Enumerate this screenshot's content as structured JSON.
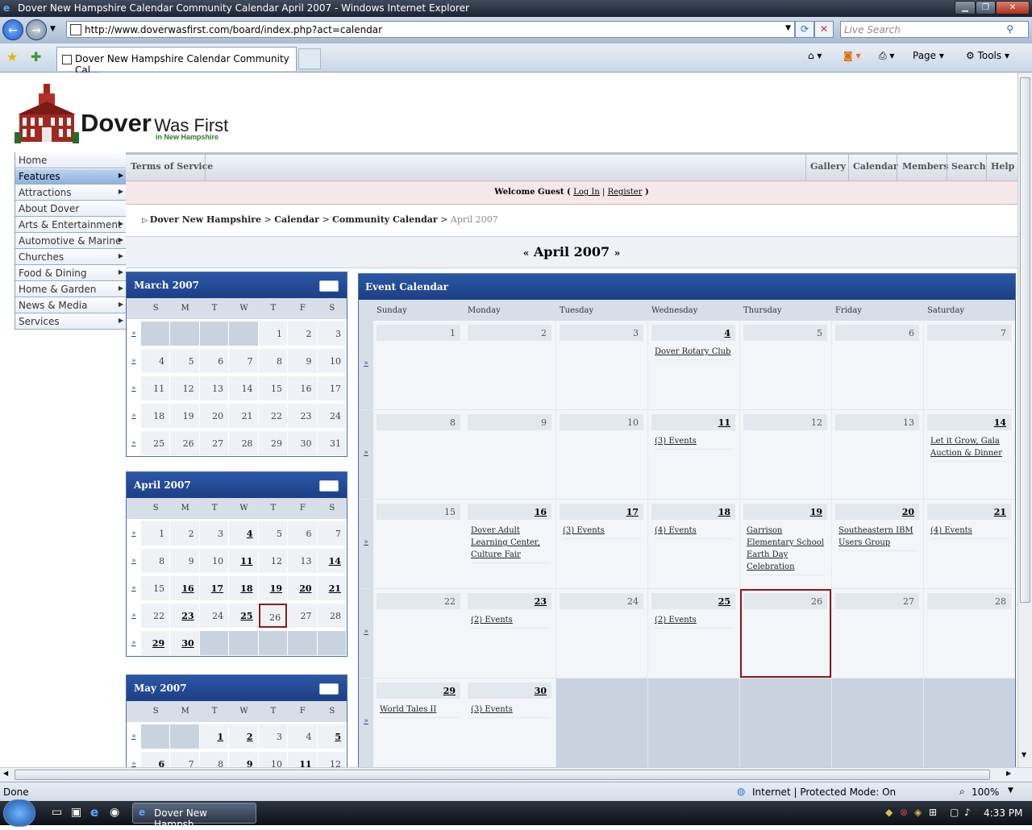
{
  "browser": {
    "window_title": "Dover New Hampshire Calendar Community Calendar April 2007 - Windows Internet Explorer",
    "url": "http://www.doverwasfirst.com/board/index.php?act=calendar",
    "search_placeholder": "Live Search",
    "tab_title": "Dover New Hampshire Calendar Community Cal...",
    "page_label": "Page",
    "tools_label": "Tools",
    "status_text": "Done",
    "zone_text": "Internet | Protected Mode: On",
    "zoom": "100%",
    "taskbar_item": "Dover New Hampsh...",
    "clock": "4:33 PM"
  },
  "site": {
    "logo_main": "Dover",
    "logo_second": "Was First",
    "logo_sub": "in New Hampshire",
    "side_nav": [
      {
        "label": "Home",
        "arrow": ""
      },
      {
        "label": "Features",
        "arrow": "▶"
      },
      {
        "label": "Attractions",
        "arrow": "▶"
      },
      {
        "label": "About Dover",
        "arrow": ""
      },
      {
        "label": "Arts & Entertainment",
        "arrow": "▶"
      },
      {
        "label": "Automotive & Marine",
        "arrow": "▶"
      },
      {
        "label": "Churches",
        "arrow": "▶"
      },
      {
        "label": "Food & Dining",
        "arrow": "▶"
      },
      {
        "label": "Home & Garden",
        "arrow": "▶"
      },
      {
        "label": "News & Media",
        "arrow": "▶"
      },
      {
        "label": "Services",
        "arrow": "▶"
      }
    ],
    "terms": "Terms of Service",
    "top_nav": [
      "Gallery",
      "Calendar",
      "Members",
      "Search",
      "Help"
    ],
    "welcome_prefix": "Welcome Guest ( ",
    "login": "Log In",
    "sep": " | ",
    "register": "Register",
    "welcome_suffix": " )",
    "breadcrumb": [
      "Dover New Hampshire",
      "Calendar",
      "Community Calendar",
      "April 2007"
    ],
    "breadcrumb_sep": " > ",
    "month_prev": "«",
    "month_title": "April 2007",
    "month_next": "»"
  },
  "day_initials": [
    "S",
    "M",
    "T",
    "W",
    "T",
    "F",
    "S"
  ],
  "week_link": "»",
  "mini_calendars": [
    {
      "title": "March 2007",
      "rows": [
        [
          "",
          "",
          "",
          "",
          "1",
          "2",
          "3"
        ],
        [
          "4",
          "5",
          "6",
          "7",
          "8",
          "9",
          "10"
        ],
        [
          "11",
          "12",
          "13",
          "14",
          "15",
          "16",
          "17"
        ],
        [
          "18",
          "19",
          "20",
          "21",
          "22",
          "23",
          "24"
        ],
        [
          "25",
          "26",
          "27",
          "28",
          "29",
          "30",
          "31"
        ]
      ],
      "bold": []
    },
    {
      "title": "April 2007",
      "rows": [
        [
          "1",
          "2",
          "3",
          "4",
          "5",
          "6",
          "7"
        ],
        [
          "8",
          "9",
          "10",
          "11",
          "12",
          "13",
          "14"
        ],
        [
          "15",
          "16",
          "17",
          "18",
          "19",
          "20",
          "21"
        ],
        [
          "22",
          "23",
          "24",
          "25",
          "26",
          "27",
          "28"
        ],
        [
          "29",
          "30",
          "",
          "",
          "",
          "",
          ""
        ]
      ],
      "bold": [
        "4",
        "11",
        "14",
        "16",
        "17",
        "18",
        "19",
        "20",
        "21",
        "23",
        "25",
        "29",
        "30"
      ],
      "today": "26"
    },
    {
      "title": "May 2007",
      "rows": [
        [
          "",
          "",
          "1",
          "2",
          "3",
          "4",
          "5"
        ],
        [
          "6",
          "7",
          "8",
          "9",
          "10",
          "11",
          "12"
        ]
      ],
      "bold": [
        "1",
        "2",
        "5",
        "6",
        "9",
        "11"
      ]
    }
  ],
  "event_calendar": {
    "title": "Event Calendar",
    "days": [
      "Sunday",
      "Monday",
      "Tuesday",
      "Wednesday",
      "Thursday",
      "Friday",
      "Saturday"
    ],
    "weeks": [
      [
        {
          "d": "1"
        },
        {
          "d": "2"
        },
        {
          "d": "3"
        },
        {
          "d": "4",
          "ev": "Dover Rotary Club"
        },
        {
          "d": "5"
        },
        {
          "d": "6"
        },
        {
          "d": "7"
        }
      ],
      [
        {
          "d": "8"
        },
        {
          "d": "9"
        },
        {
          "d": "10"
        },
        {
          "d": "11",
          "ev": "(3) Events"
        },
        {
          "d": "12"
        },
        {
          "d": "13"
        },
        {
          "d": "14",
          "ev": "Let it Grow, Gala Auction & Dinner"
        }
      ],
      [
        {
          "d": "15"
        },
        {
          "d": "16",
          "ev": "Dover Adult Learning Center, Culture Fair"
        },
        {
          "d": "17",
          "ev": "(3) Events"
        },
        {
          "d": "18",
          "ev": "(4) Events"
        },
        {
          "d": "19",
          "ev": "Garrison Elementary School Earth Day Celebration"
        },
        {
          "d": "20",
          "ev": "Southeastern IBM Users Group"
        },
        {
          "d": "21",
          "ev": "(4) Events"
        }
      ],
      [
        {
          "d": "22"
        },
        {
          "d": "23",
          "ev": "(2) Events"
        },
        {
          "d": "24"
        },
        {
          "d": "25",
          "ev": "(2) Events"
        },
        {
          "d": "26",
          "today": true
        },
        {
          "d": "27"
        },
        {
          "d": "28"
        }
      ],
      [
        {
          "d": "29",
          "ev": "World Tales II"
        },
        {
          "d": "30",
          "ev": "(3) Events"
        },
        {
          "d": ""
        },
        {
          "d": ""
        },
        {
          "d": ""
        },
        {
          "d": ""
        },
        {
          "d": ""
        }
      ]
    ]
  }
}
